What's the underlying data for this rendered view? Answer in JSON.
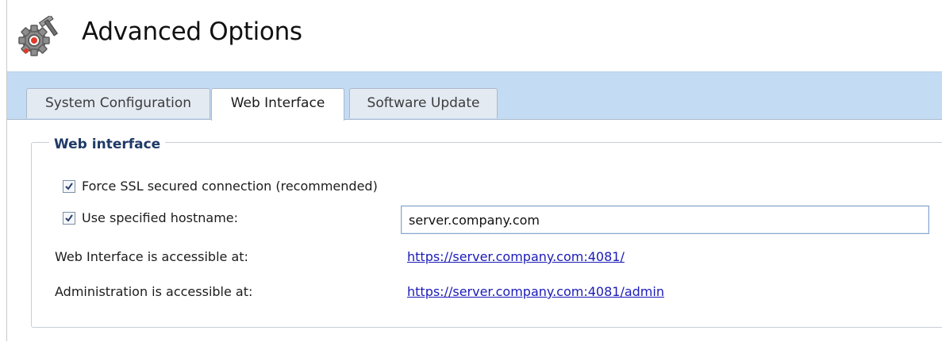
{
  "header": {
    "title": "Advanced Options",
    "icon": "gear-wrench-icon"
  },
  "tabs": [
    {
      "label": "System Configuration",
      "active": false
    },
    {
      "label": "Web Interface",
      "active": true
    },
    {
      "label": "Software Update",
      "active": false
    }
  ],
  "web_interface": {
    "legend": "Web interface",
    "force_ssl": {
      "label": "Force SSL secured connection (recommended)",
      "checked": true
    },
    "use_hostname": {
      "label": "Use specified hostname:",
      "checked": true,
      "value": "server.company.com"
    },
    "web_access": {
      "label": "Web Interface is accessible at:",
      "url": "https://server.company.com:4081/"
    },
    "admin_access": {
      "label": "Administration is accessible at:",
      "url": "https://server.company.com:4081/admin"
    }
  },
  "colors": {
    "tab_bar": "#c4dbf4",
    "legend": "#1f3a66",
    "link": "#1b1bb8"
  }
}
